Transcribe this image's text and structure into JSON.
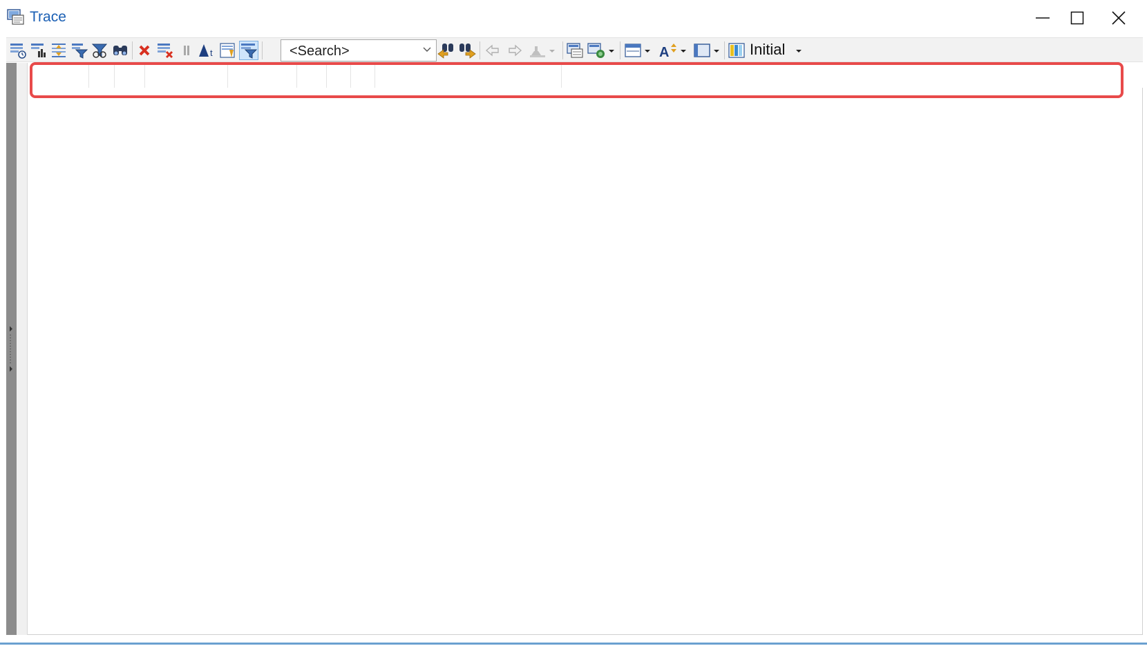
{
  "window": {
    "title": "Trace",
    "controls": {
      "minimize": "minimize",
      "maximize": "maximize",
      "close": "close"
    }
  },
  "toolbar": {
    "search": {
      "value": "<Search>"
    },
    "initial_label": "Initial"
  },
  "colors": {
    "title": "#1a5fb4",
    "highlight": "#e84a4a",
    "toolbar_bg": "#f2f2f2"
  }
}
